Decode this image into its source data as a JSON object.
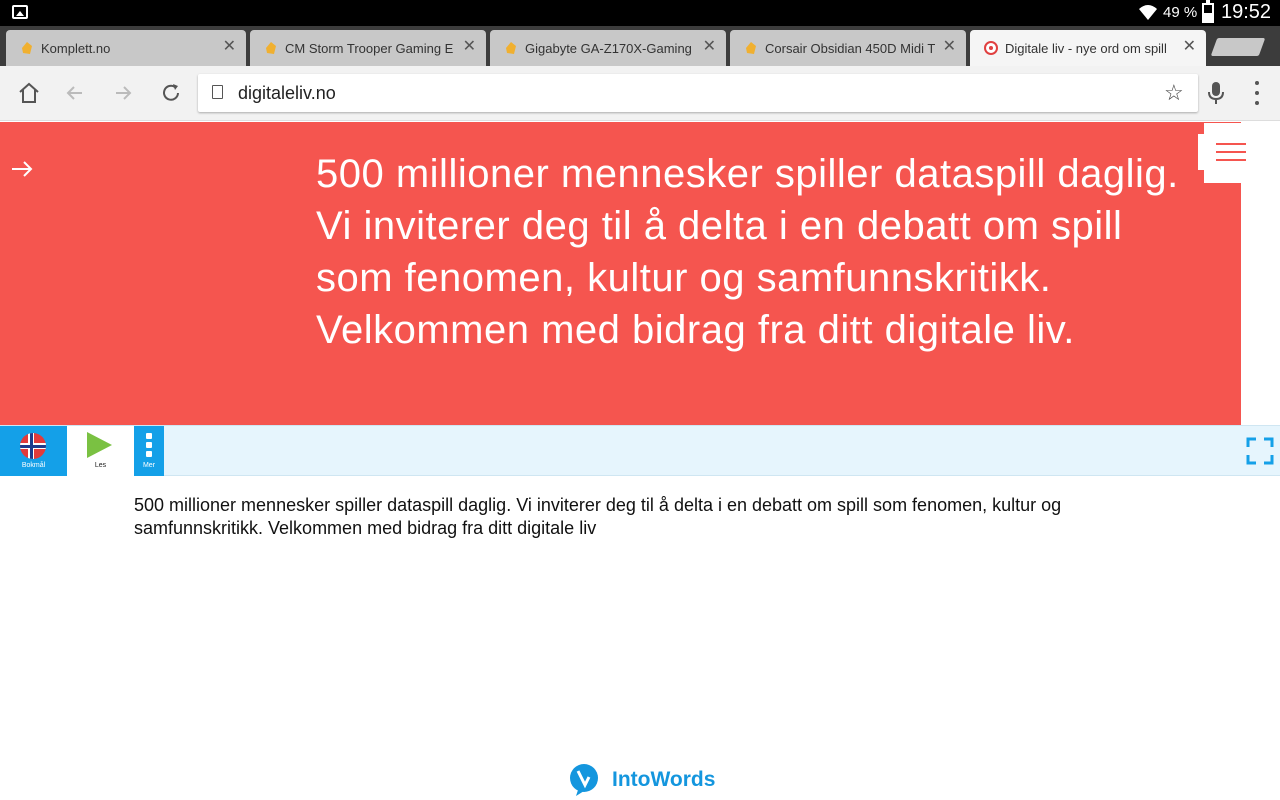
{
  "status_bar": {
    "battery_percent": "49 %",
    "battery_level": 0.49,
    "time": "19:52",
    "icons": [
      "gallery-icon",
      "wifi-icon",
      "battery-icon"
    ]
  },
  "tabs": [
    {
      "title": "Komplett.no",
      "favicon": "komplett-favicon",
      "active": false
    },
    {
      "title": "CM Storm Trooper Gaming E",
      "favicon": "komplett-favicon",
      "active": false
    },
    {
      "title": "Gigabyte GA-Z170X-Gaming",
      "favicon": "komplett-favicon",
      "active": false
    },
    {
      "title": "Corsair Obsidian 450D Midi T",
      "favicon": "komplett-favicon",
      "active": false
    },
    {
      "title": "Digitale liv - nye ord om spill",
      "favicon": "digitaleliv-favicon",
      "active": true
    }
  ],
  "toolbar": {
    "url": "digitaleliv.no",
    "icons": [
      "home-icon",
      "back-icon",
      "forward-icon",
      "reload-icon",
      "page-icon",
      "star-icon",
      "mic-icon",
      "overflow-menu-icon"
    ]
  },
  "hero": {
    "text": "500 millioner mennesker spiller dataspill daglig. Vi inviterer deg til å delta i en debatt om spill som fenomen, kultur og samfunnskritikk. Velkommen med bidrag fra ditt digitale liv.",
    "background_color": "#f5554f"
  },
  "intowords_bar": {
    "language_label": "Bokmål",
    "read_label": "Les",
    "more_label": "Mer",
    "accent_color": "#14a0e8",
    "play_color": "#7ac142"
  },
  "body_text": "500 millioner mennesker spiller dataspill daglig. Vi inviterer deg til å delta i en debatt om spill som fenomen, kultur og samfunnskritikk. Velkommen med bidrag fra ditt digitale liv",
  "footer": {
    "logo_text": "IntoWords",
    "logo_color": "#1496de"
  }
}
